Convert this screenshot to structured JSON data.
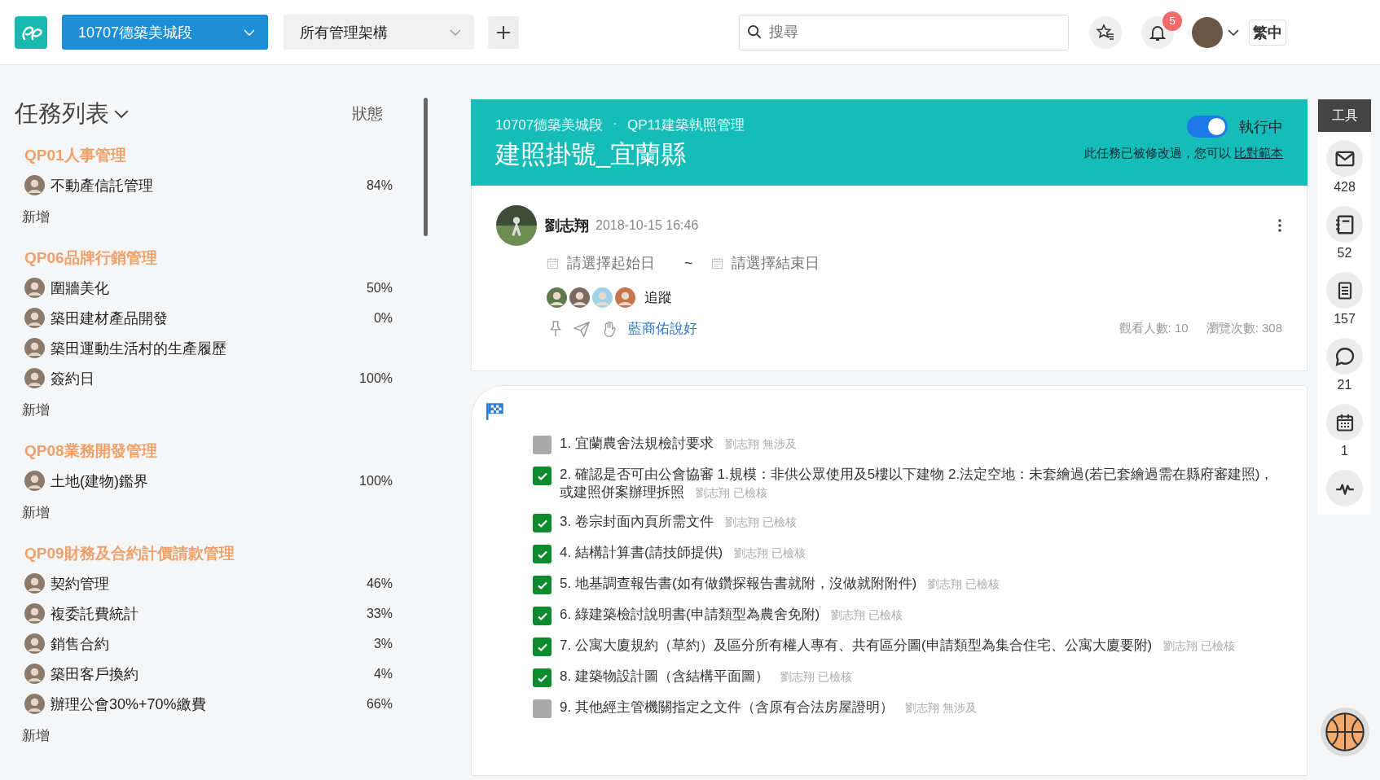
{
  "topbar": {
    "project": "10707德築美城段",
    "org": "所有管理架構",
    "search_placeholder": "搜尋",
    "notification_count": "5",
    "language": "繁中"
  },
  "task_list": {
    "title": "任務列表",
    "status_header": "狀態",
    "groups": [
      {
        "name": "QP01人事管理",
        "tasks": [
          {
            "name": "不動產信託管理",
            "percent": "84%"
          }
        ],
        "add_label": "新增"
      },
      {
        "name": "QP06品牌行銷管理",
        "tasks": [
          {
            "name": "圍牆美化",
            "percent": "50%"
          },
          {
            "name": "築田建材產品開發",
            "percent": "0%"
          },
          {
            "name": "築田運動生活村的生產履歷"
          },
          {
            "name": "簽約日",
            "percent": "100%"
          }
        ],
        "add_label": "新增"
      },
      {
        "name": "QP08業務開發管理",
        "tasks": [
          {
            "name": "土地(建物)鑑界",
            "percent": "100%"
          }
        ],
        "add_label": "新增"
      },
      {
        "name": "QP09財務及合約計價請款管理",
        "tasks": [
          {
            "name": "契約管理",
            "percent": "46%"
          },
          {
            "name": "複委託費統計",
            "percent": "33%"
          },
          {
            "name": "銷售合約",
            "percent": "3%"
          },
          {
            "name": "築田客戶換約",
            "percent": "4%"
          },
          {
            "name": "辦理公會30%+70%繳費",
            "percent": "66%"
          }
        ],
        "add_label": "新增"
      }
    ]
  },
  "task_header": {
    "breadcrumb": [
      "10707德築美城段",
      "QP11建築執照管理"
    ],
    "breadcrumb_separator": "·",
    "title": "建照掛號_宜蘭縣",
    "running": {
      "on": true,
      "label": "執行中"
    },
    "notice": "此任務已被修改過，您可以",
    "notice_link": "比對範本"
  },
  "post": {
    "author": "劉志翔",
    "time": "2018-10-15 16:46",
    "start_placeholder": "請選擇起始日",
    "range_separator": "~",
    "end_placeholder": "請選擇結束日",
    "follow_label": "追蹤",
    "liked_by": "藍商佑說好",
    "viewers": "觀看人數: 10",
    "views": "瀏覽次數: 308"
  },
  "checklist": [
    {
      "text": "1. 宜蘭農舍法規檢討要求",
      "by": "劉志翔",
      "status": "無涉及",
      "checked": false
    },
    {
      "text": "2. 確認是否可由公會協審 1.規模：非供公眾使用及5樓以下建物 2.法定空地：未套繪過(若已套繪過需在縣府審建照)，或建照併案辦理拆照",
      "by": "劉志翔",
      "status": "已檢核",
      "checked": true
    },
    {
      "text": "3. 卷宗封面內頁所需文件",
      "by": "劉志翔",
      "status": "已檢核",
      "checked": true
    },
    {
      "text": "4. 結構計算書(請技師提供)",
      "by": "劉志翔",
      "status": "已檢核",
      "checked": true
    },
    {
      "text": "5. 地基調查報告書(如有做鑽探報告書就附，沒做就附附件)",
      "by": "劉志翔",
      "status": "已檢核",
      "checked": true
    },
    {
      "text": "6. 綠建築檢討說明書(申請類型為農舍免附)",
      "by": "劉志翔",
      "status": "已檢核",
      "checked": true
    },
    {
      "text": "7. 公寓大廈規約（草約）及區分所有權人專有、共有區分圖(申請類型為集合住宅、公寓大廈要附)",
      "by": "劉志翔",
      "status": "已檢核",
      "checked": true
    },
    {
      "text": "8. 建築物設計圖（含結構平面圖）",
      "by": "劉志翔",
      "status": "已檢核",
      "checked": true
    },
    {
      "text": "9. 其他經主管機關指定之文件（含原有合法房屋證明）",
      "by": "劉志翔",
      "status": "無涉及",
      "checked": false
    }
  ],
  "tools": {
    "title": "工具",
    "items": [
      {
        "kind": "mail",
        "count": "428"
      },
      {
        "kind": "notebook",
        "count": "52"
      },
      {
        "kind": "document",
        "count": "157"
      },
      {
        "kind": "comment",
        "count": "21"
      },
      {
        "kind": "calendar",
        "count": "1"
      },
      {
        "kind": "activity"
      }
    ]
  }
}
